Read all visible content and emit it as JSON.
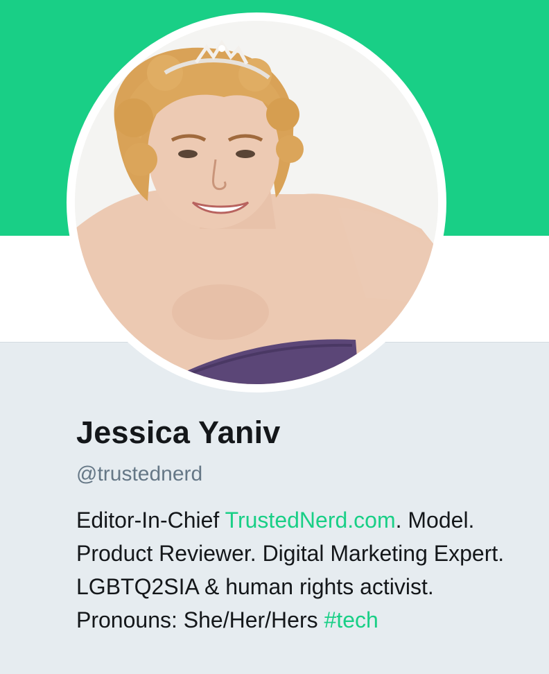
{
  "profile": {
    "display_name": "Jessica Yaniv",
    "screen_name": "@trustednerd",
    "bio": {
      "part1": "Editor-In-Chief ",
      "link": "TrustedNerd.com",
      "part2": ". Model. Product Reviewer. Digital Marketing Expert. LGBTQ2SIA & human rights activist. Pronouns: She/Her/Hers ",
      "hashtag": "#tech"
    }
  },
  "colors": {
    "header_banner": "#19cf86",
    "link": "#19cf86",
    "background": "#e6ecf0",
    "name_text": "#14171a",
    "handle_text": "#657786"
  }
}
